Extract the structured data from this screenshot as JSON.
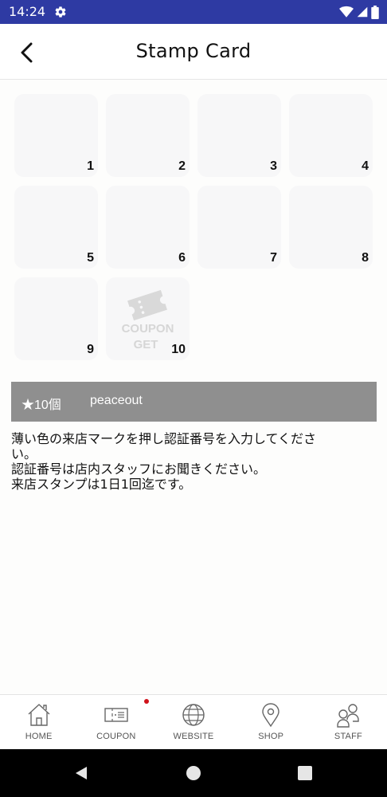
{
  "status_bar": {
    "time": "14:24"
  },
  "header": {
    "title": "Stamp Card"
  },
  "stamp_card": {
    "stamps": [
      {
        "number": "1"
      },
      {
        "number": "2"
      },
      {
        "number": "3"
      },
      {
        "number": "4"
      },
      {
        "number": "5"
      },
      {
        "number": "6"
      },
      {
        "number": "7"
      },
      {
        "number": "8"
      },
      {
        "number": "9"
      },
      {
        "number": "10"
      }
    ],
    "coupon_line1": "COUPON",
    "coupon_line2": "GET"
  },
  "info_bar": {
    "count": "★10個",
    "name": "peaceout"
  },
  "instructions": {
    "line1": "薄い色の来店マークを押し認証番号を入力してくださ",
    "line2": "い。",
    "line3": "認証番号は店内スタッフにお聞きください。",
    "line4": "来店スタンプは1日1回迄です。"
  },
  "bottom_nav": {
    "items": [
      {
        "label": "HOME",
        "icon": "home-icon"
      },
      {
        "label": "COUPON",
        "icon": "ticket-icon"
      },
      {
        "label": "WEBSITE",
        "icon": "globe-icon"
      },
      {
        "label": "SHOP",
        "icon": "location-pin-icon"
      },
      {
        "label": "STAFF",
        "icon": "people-icon"
      }
    ]
  },
  "colors": {
    "status_bar": "#2e3aa3",
    "info_bar": "#8f8f8f",
    "notification_dot": "#d0121b",
    "stamp_bg": "#f7f7f8"
  }
}
